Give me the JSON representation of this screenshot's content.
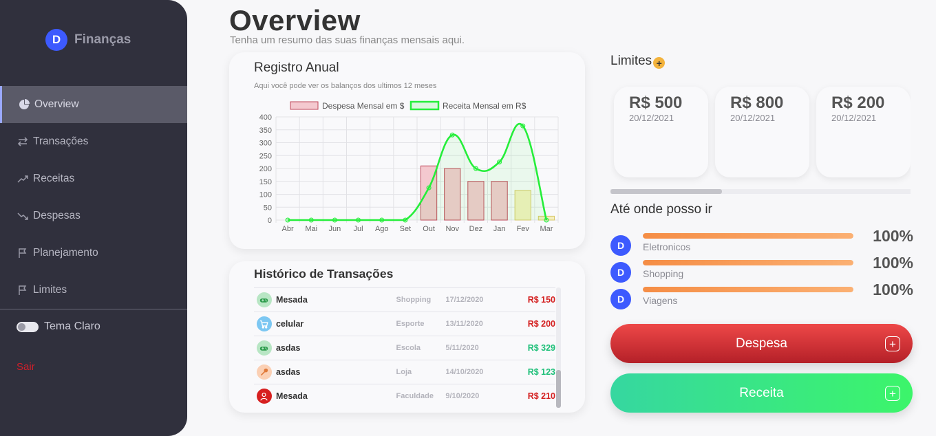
{
  "sidebar": {
    "brand": {
      "logo_letter": "D",
      "name": "Finanças"
    },
    "items": [
      {
        "label": "Overview",
        "icon": "pie-chart-icon",
        "active": true
      },
      {
        "label": "Transações",
        "icon": "swap-arrows-icon"
      },
      {
        "label": "Receitas",
        "icon": "trend-up-icon"
      },
      {
        "label": "Despesas",
        "icon": "trend-down-icon"
      },
      {
        "label": "Planejamento",
        "icon": "flag-icon"
      },
      {
        "label": "Limites",
        "icon": "flag-icon"
      }
    ],
    "theme_label": "Tema Claro",
    "logout_label": "Sair"
  },
  "header": {
    "title": "Overview",
    "subtitle": "Tenha um resumo das suas finanças mensais aqui."
  },
  "annual": {
    "title": "Registro Anual",
    "subtitle": "Aqui você pode ver os balanços dos ultimos 12 meses"
  },
  "chart_data": {
    "type": "bar",
    "categories": [
      "Abr",
      "Mai",
      "Jun",
      "Jul",
      "Ago",
      "Set",
      "Out",
      "Nov",
      "Dez",
      "Jan",
      "Fev",
      "Mar"
    ],
    "series": [
      {
        "name": "Despesa Mensal em $",
        "type": "bar",
        "values": [
          0,
          0,
          0,
          0,
          0,
          0,
          210,
          200,
          150,
          150,
          115,
          15
        ]
      },
      {
        "name": "Receita Mensal em R$",
        "type": "line",
        "values": [
          0,
          0,
          0,
          0,
          0,
          0,
          125,
          330,
          200,
          225,
          365,
          0
        ]
      }
    ],
    "ylim": [
      0,
      400
    ],
    "yticks": [
      0,
      50,
      100,
      150,
      200,
      250,
      300,
      350,
      400
    ],
    "grid": true,
    "legend": "top",
    "colors": {
      "bar_fill": "#f4c9cf",
      "bar_stroke": "#c0485a",
      "bar_alt_fill": "#f5efbf",
      "bar_alt_stroke": "#d8c86a",
      "line": "#25ee3a"
    }
  },
  "history": {
    "title": "Histórico de Transações",
    "rows": [
      {
        "name": "Mesada",
        "category": "Shopping",
        "date": "17/12/2020",
        "value": "R$ 150",
        "kind": "despesa",
        "icon": "gamepad-icon",
        "icon_bg": "#b8e6c4",
        "icon_color": "#2a9a4a"
      },
      {
        "name": "celular",
        "category": "Esporte",
        "date": "13/11/2020",
        "value": "R$ 200",
        "kind": "despesa",
        "icon": "cart-icon",
        "icon_bg": "#7cc7f2",
        "icon_color": "#ffffff"
      },
      {
        "name": "asdas",
        "category": "Escola",
        "date": "5/11/2020",
        "value": "R$ 329",
        "kind": "receita",
        "icon": "gamepad-icon",
        "icon_bg": "#b8e6c4",
        "icon_color": "#2a9a4a"
      },
      {
        "name": "asdas",
        "category": "Loja",
        "date": "14/10/2020",
        "value": "R$ 123",
        "kind": "receita",
        "icon": "tools-icon",
        "icon_bg": "#fbd0b4",
        "icon_color": "#e07a3a"
      },
      {
        "name": "Mesada",
        "category": "Faculdade",
        "date": "9/10/2020",
        "value": "R$ 210",
        "kind": "despesa",
        "icon": "user-icon",
        "icon_bg": "#d72020",
        "icon_color": "#ffffff"
      }
    ]
  },
  "limits": {
    "title": "Limites",
    "cards": [
      {
        "value": "R$ 500",
        "date": "20/12/2021"
      },
      {
        "value": "R$ 800",
        "date": "20/12/2021"
      },
      {
        "value": "R$ 200",
        "date": "20/12/2021"
      }
    ]
  },
  "progress": {
    "title": "Até onde posso ir",
    "items": [
      {
        "label": "Eletronicos",
        "percent": "100%",
        "fill": 1.0,
        "avatar": "D"
      },
      {
        "label": "Shopping",
        "percent": "100%",
        "fill": 1.0,
        "avatar": "D"
      },
      {
        "label": "Viagens",
        "percent": "100%",
        "fill": 1.0,
        "avatar": "D"
      }
    ]
  },
  "actions": {
    "despesa_label": "Despesa",
    "receita_label": "Receita",
    "plus": "+"
  },
  "colors": {
    "despesa_value": "#d42020",
    "receita_value": "#20c07a"
  }
}
